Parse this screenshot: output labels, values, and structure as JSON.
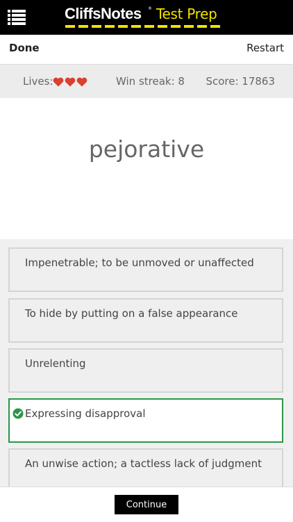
{
  "header": {
    "brand": "CliffsNotes",
    "brand_mark": "®",
    "product": "Test Prep",
    "menu_icon": "menu-icon",
    "colors": {
      "background": "#000000",
      "accent": "#f4e200"
    }
  },
  "toolbar": {
    "done_label": "Done",
    "restart_label": "Restart"
  },
  "stats": {
    "lives_label": "Lives:",
    "lives": 3,
    "heart_icon": "heart-icon",
    "heart_color": "#d9402f",
    "streak_label": "Win streak: 8",
    "score_label": "Score: 17863"
  },
  "question": {
    "word": "pejorative"
  },
  "answers": [
    {
      "label": "Impenetrable; to be unmoved or unaffected",
      "correct": false
    },
    {
      "label": "To hide by putting on a false appearance",
      "correct": false
    },
    {
      "label": "Unrelenting",
      "correct": false
    },
    {
      "label": "Expressing disapproval",
      "correct": true,
      "icon": "check-circle-icon",
      "color": "#2a9645"
    },
    {
      "label": "An unwise action; a tactless lack of judgment",
      "correct": false
    }
  ],
  "footer": {
    "continue_label": "Continue"
  }
}
